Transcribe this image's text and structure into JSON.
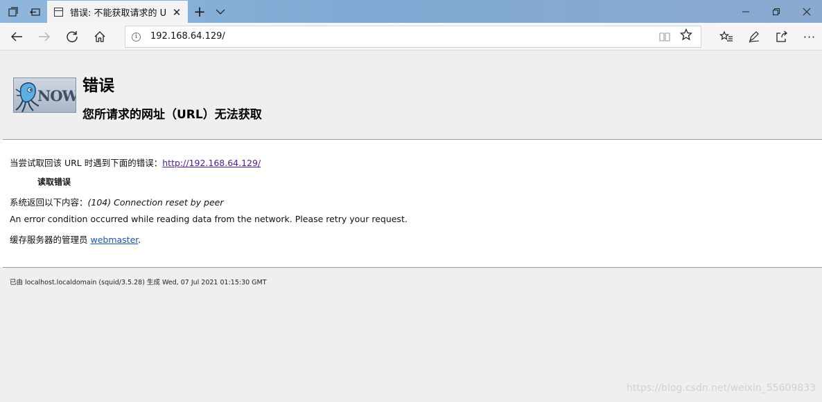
{
  "browser": {
    "tab": {
      "title": "错误: 不能获取请求的 U"
    },
    "address": {
      "url": "192.168.64.129/"
    },
    "icons": {
      "tab_set_aside": "tabs-icon",
      "tab_back": "set-aside-icon",
      "new_tab": "plus-icon",
      "tab_list": "chevron-down-icon",
      "minimize": "minimize-icon",
      "restore": "restore-icon",
      "close": "close-icon",
      "back": "back-arrow-icon",
      "forward": "forward-arrow-icon",
      "refresh": "refresh-icon",
      "home": "home-icon",
      "info": "info-icon",
      "reading_view": "reading-view-icon",
      "favorite": "star-icon",
      "favorites_hub": "favorites-list-icon",
      "notes": "pen-icon",
      "share": "share-icon",
      "more": "more-icon"
    }
  },
  "page": {
    "title": "错误",
    "subtitle": "您所请求的网址（URL）无法获取",
    "logo_text": "NOW",
    "attempt_prefix": "当尝试取回该 URL 时遇到下面的错误：",
    "attempt_url": "http://192.168.64.129/",
    "error_name": "读取错误",
    "system_prefix": "系统返回以下内容：",
    "system_message": "(104) Connection reset by peer",
    "description": "An error condition occurred while reading data from the network. Please retry your request.",
    "admin_prefix": "缓存服务器的管理员 ",
    "admin_link": "webmaster",
    "admin_suffix": ".",
    "footer": "已由 localhost.localdomain (squid/3.5.28) 生成 Wed, 07 Jul 2021 01:15:30 GMT",
    "watermark": "https://blog.csdn.net/weixin_55609833"
  },
  "colors": {
    "titlebar": "#8fb7dc",
    "visited_link": "#551a8b",
    "link": "#1a56b0"
  }
}
